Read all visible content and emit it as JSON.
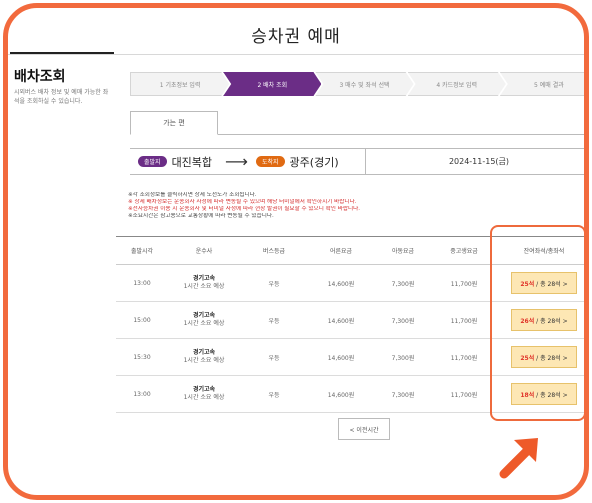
{
  "header": {
    "title": "승차권 예매"
  },
  "sidebar": {
    "title": "배차조회",
    "description": "시외버스 배차 정보 및 예매 가능한 좌석을 조회하실 수 있습니다."
  },
  "steps": [
    {
      "label": "1 기초정보 입력",
      "active": false
    },
    {
      "label": "2 배차 조회",
      "active": true
    },
    {
      "label": "3 매수 및 좌석 선택",
      "active": false
    },
    {
      "label": "4 카드정보 입력",
      "active": false
    },
    {
      "label": "5 예매 결과",
      "active": false
    }
  ],
  "tabs": {
    "oneway": "가는 편"
  },
  "route": {
    "departure_badge": "출발지",
    "departure": "대진복합",
    "arrival_badge": "도착지",
    "arrival": "광주(경기)",
    "date": "2024-11-15(금)"
  },
  "notices": [
    {
      "text": "※각 조회정보를 클릭하시면 상세 노선도가 조회됩니다.",
      "red": false
    },
    {
      "text": "※ 상세 배차정보는 운송회사 사정에 따라 변동될 수 있으며 해당 터미널에서 확인하시기 바랍니다.",
      "red": true
    },
    {
      "text": "※전자승차권 이용 시 운송회사 및 터미널 사정에 따라 현장 발권이 필요할 수 있으니 확인 바랍니다.",
      "red": true
    },
    {
      "text": "※소요시간은 참고용으로 교통상황에 따라 변동될 수 있습니다.",
      "red": false
    }
  ],
  "table": {
    "headers": [
      "출발시각",
      "운수사",
      "버스등급",
      "어른요금",
      "아동요금",
      "중고생요금",
      "잔여좌석/총좌석"
    ],
    "rows": [
      {
        "time": "13:00",
        "company": "경기고속",
        "duration": "1시간 소요 예상",
        "grade": "우등",
        "adult": "14,600원",
        "child": "7,300원",
        "teen": "11,700원",
        "remaining": "25석",
        "total": "/ 총 28석 >"
      },
      {
        "time": "15:00",
        "company": "경기고속",
        "duration": "1시간 소요 예상",
        "grade": "우등",
        "adult": "14,600원",
        "child": "7,300원",
        "teen": "11,700원",
        "remaining": "26석",
        "total": "/ 총 28석 >"
      },
      {
        "time": "15:30",
        "company": "경기고속",
        "duration": "1시간 소요 예상",
        "grade": "우등",
        "adult": "14,600원",
        "child": "7,300원",
        "teen": "11,700원",
        "remaining": "25석",
        "total": "/ 총 28석 >"
      },
      {
        "time": "13:00",
        "company": "경기고속",
        "duration": "1시간 소요 예상",
        "grade": "우등",
        "adult": "14,600원",
        "child": "7,300원",
        "teen": "11,700원",
        "remaining": "18석",
        "total": "/ 총 28석 >"
      }
    ]
  },
  "prev_button": "< 이전시간",
  "colors": {
    "accent": "#6b2d86",
    "annotation": "#f26a3d",
    "arrival": "#e06a12"
  }
}
